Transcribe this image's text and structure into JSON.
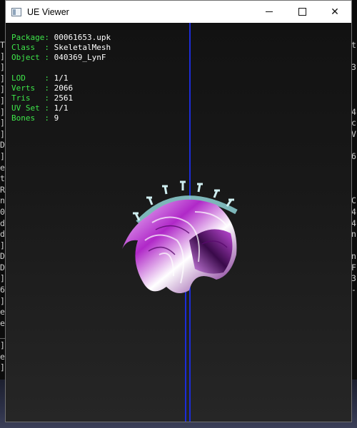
{
  "window": {
    "title": "UE Viewer"
  },
  "controls": {
    "minimize": "",
    "maximize": "",
    "close": "✕"
  },
  "info": {
    "package": {
      "label": "Package:",
      "value": "00061653.upk"
    },
    "class": {
      "label": "Class  :",
      "value": "SkeletalMesh"
    },
    "object": {
      "label": "Object :",
      "value": "040369_LynF"
    },
    "lod": {
      "label": "LOD    :",
      "value": "1/1"
    },
    "verts": {
      "label": "Verts  :",
      "value": "2066"
    },
    "tris": {
      "label": "Tris   :",
      "value": "2561"
    },
    "uvset": {
      "label": "UV Set :",
      "value": "1/1"
    },
    "bones": {
      "label": "Bones  :",
      "value": "9"
    }
  },
  "background_console": {
    "left": [
      "T",
      "]",
      "]",
      "]",
      "]",
      "]",
      "]",
      "]",
      "]",
      "D",
      "]",
      "e",
      "t",
      "R",
      "n",
      "0",
      "d",
      "d",
      "]",
      "D",
      "D",
      "]",
      "6",
      "]",
      "e",
      "e",
      "_",
      "]",
      "e",
      "]"
    ],
    "right": [
      "t",
      "",
      "3",
      "",
      "",
      "",
      "4",
      "c",
      "V",
      "",
      "6",
      "",
      "",
      "",
      "C",
      "4",
      "4",
      "n",
      "",
      "n",
      "F",
      "3",
      "-",
      ""
    ]
  },
  "colors": {
    "label_green": "#3ee64a",
    "value_white": "#ffffff",
    "axis_blue": "#1c2cd8",
    "hair_purple": "#b028c8"
  }
}
